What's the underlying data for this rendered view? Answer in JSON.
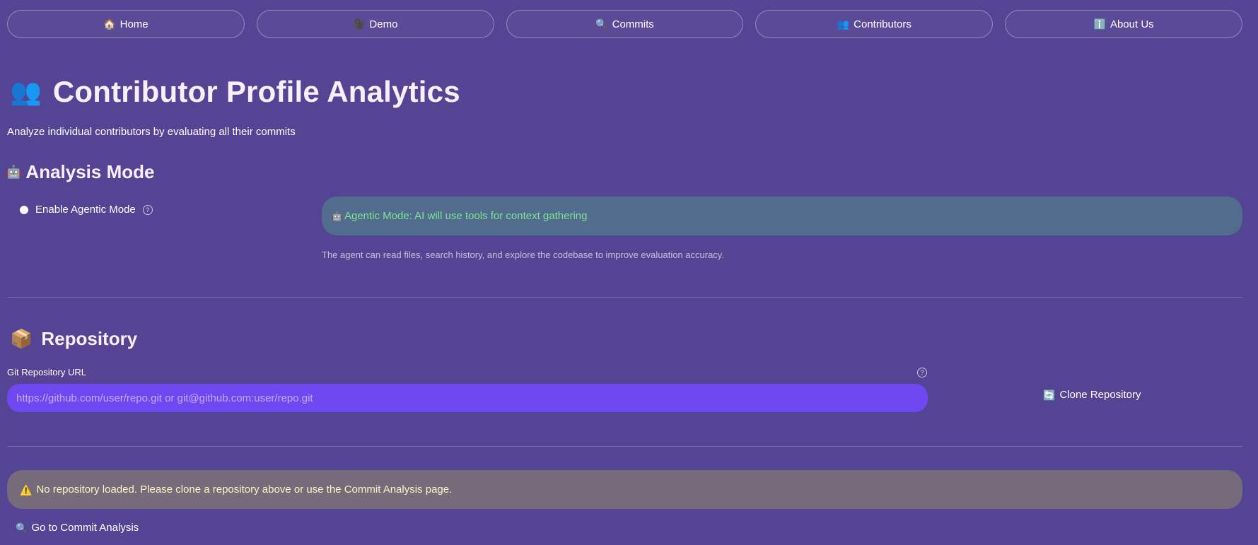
{
  "nav": {
    "items": [
      {
        "icon": "🏠",
        "label": "Home"
      },
      {
        "icon": "🎥",
        "label": "Demo"
      },
      {
        "icon": "🔍",
        "label": "Commits"
      },
      {
        "icon": "👥",
        "label": "Contributors"
      },
      {
        "icon": "ℹ️",
        "label": "About Us"
      }
    ]
  },
  "header": {
    "icon": "👥",
    "title": "Contributor Profile Analytics",
    "subtitle": "Analyze individual contributors by evaluating all their commits"
  },
  "analysis_mode": {
    "icon": "🤖",
    "heading": "Analysis Mode",
    "toggle_label": "Enable Agentic Mode",
    "help_glyph": "?",
    "info_icon": "🤖",
    "info_text": "Agentic Mode: AI will use tools for context gathering",
    "caption": "The agent can read files, search history, and explore the codebase to improve evaluation accuracy."
  },
  "repository": {
    "icon": "📦",
    "heading": "Repository",
    "field_label": "Git Repository URL",
    "help_glyph": "?",
    "input_value": "",
    "input_placeholder": "https://github.com/user/repo.git or git@github.com:user/repo.git",
    "clone_icon": "🔄",
    "clone_label": "Clone Repository"
  },
  "warning": {
    "icon": "⚠️",
    "text": "No repository loaded. Please clone a repository above or use the Commit Analysis page."
  },
  "commit_link": {
    "icon": "🔍",
    "label": "Go to Commit Analysis"
  },
  "colors": {
    "background": "#534593",
    "input": "#7048f2",
    "info_box": "#526c8e",
    "info_text": "#7fe29a",
    "warning_box": "#766b7b",
    "warning_text": "#fff5c2"
  }
}
